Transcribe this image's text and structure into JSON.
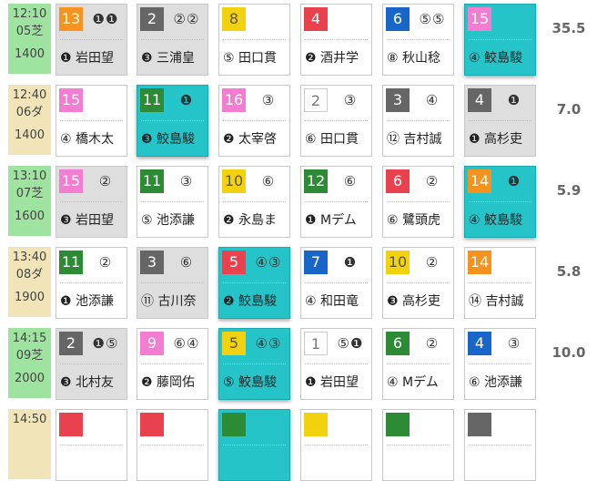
{
  "races": [
    {
      "time": "12:10",
      "race": "05芝",
      "distance": "1400",
      "surface": "turf",
      "odds": "35.5",
      "cells": [
        {
          "num": "13",
          "color": "c7",
          "marks": "❶❶",
          "jockey": "❶ 岩田望",
          "state": "dim"
        },
        {
          "num": "2",
          "color": "c2",
          "marks": "②②",
          "jockey": "❸ 三浦皇",
          "state": "dim"
        },
        {
          "num": "8",
          "color": "c5",
          "marks": "",
          "jockey": "⑤ 田口貫",
          "state": "normal"
        },
        {
          "num": "4",
          "color": "c3",
          "marks": "",
          "jockey": "❷ 酒井学",
          "state": "normal"
        },
        {
          "num": "6",
          "color": "c4",
          "marks": "⑤⑤",
          "jockey": "⑧ 秋山稔",
          "state": "normal"
        },
        {
          "num": "15",
          "color": "c8",
          "marks": "",
          "jockey": "④ 鮫島駿",
          "state": "hl"
        }
      ]
    },
    {
      "time": "12:40",
      "race": "06ダ",
      "distance": "1400",
      "surface": "dirt",
      "odds": "7.0",
      "cells": [
        {
          "num": "15",
          "color": "c8",
          "marks": "",
          "jockey": "④ 橋木太",
          "state": "normal"
        },
        {
          "num": "11",
          "color": "c6",
          "marks": "❶",
          "jockey": "❸ 鮫島駿",
          "state": "hl"
        },
        {
          "num": "16",
          "color": "c8",
          "marks": "③",
          "jockey": "❷ 太宰啓",
          "state": "normal"
        },
        {
          "num": "2",
          "color": "w1",
          "marks": "③",
          "jockey": "⑥ 田口貫",
          "state": "normal"
        },
        {
          "num": "3",
          "color": "c2",
          "marks": "④",
          "jockey": "⑫ 吉村誠",
          "state": "normal"
        },
        {
          "num": "4",
          "color": "c2",
          "marks": "❶",
          "jockey": "❶ 高杉吏",
          "state": "dim"
        }
      ]
    },
    {
      "time": "13:10",
      "race": "07芝",
      "distance": "1600",
      "surface": "turf",
      "odds": "5.9",
      "cells": [
        {
          "num": "15",
          "color": "c8",
          "marks": "②",
          "jockey": "❸ 岩田望",
          "state": "dim"
        },
        {
          "num": "11",
          "color": "c6",
          "marks": "③",
          "jockey": "⑤ 池添謙",
          "state": "normal"
        },
        {
          "num": "10",
          "color": "c5",
          "marks": "⑥",
          "jockey": "❷ 永島ま",
          "state": "normal"
        },
        {
          "num": "12",
          "color": "c6",
          "marks": "⑥",
          "jockey": "❶ Mデム",
          "state": "normal"
        },
        {
          "num": "6",
          "color": "c3",
          "marks": "②",
          "jockey": "⑥ 鷺頭虎",
          "state": "normal"
        },
        {
          "num": "14",
          "color": "c7",
          "marks": "❶",
          "jockey": "④ 鮫島駿",
          "state": "hl"
        }
      ]
    },
    {
      "time": "13:40",
      "race": "08ダ",
      "distance": "1900",
      "surface": "dirt",
      "odds": "5.8",
      "cells": [
        {
          "num": "11",
          "color": "c6",
          "marks": "②",
          "jockey": "❶ 池添謙",
          "state": "normal"
        },
        {
          "num": "3",
          "color": "c2",
          "marks": "⑥",
          "jockey": "⑪ 古川奈",
          "state": "dim"
        },
        {
          "num": "5",
          "color": "c3",
          "marks": "④③",
          "jockey": "❷ 鮫島駿",
          "state": "hl"
        },
        {
          "num": "7",
          "color": "c4",
          "marks": "❶",
          "jockey": "④ 和田竜",
          "state": "normal"
        },
        {
          "num": "10",
          "color": "c5",
          "marks": "②",
          "jockey": "❸ 高杉吏",
          "state": "normal"
        },
        {
          "num": "14",
          "color": "c7",
          "marks": "",
          "jockey": "⑭ 吉村誠",
          "state": "normal"
        }
      ]
    },
    {
      "time": "14:15",
      "race": "09芝",
      "distance": "2000",
      "surface": "turf",
      "odds": "10.0",
      "cells": [
        {
          "num": "2",
          "color": "c2",
          "marks": "❶⑤",
          "jockey": "❸ 北村友",
          "state": "dim"
        },
        {
          "num": "9",
          "color": "c8",
          "marks": "⑥④",
          "jockey": "❷ 藤岡佑",
          "state": "normal"
        },
        {
          "num": "5",
          "color": "c5",
          "marks": "④③",
          "jockey": "⑤ 鮫島駿",
          "state": "hl"
        },
        {
          "num": "1",
          "color": "w1",
          "marks": "⑤❶",
          "jockey": "❶ 岩田望",
          "state": "normal"
        },
        {
          "num": "6",
          "color": "c6",
          "marks": "②",
          "jockey": "④ Mデム",
          "state": "normal"
        },
        {
          "num": "4",
          "color": "c4",
          "marks": "③",
          "jockey": "⑥ 池添謙",
          "state": "normal"
        }
      ]
    },
    {
      "time": "14:50",
      "race": "",
      "distance": "",
      "surface": "dirt",
      "odds": "",
      "cells": [
        {
          "num": "",
          "color": "c3",
          "marks": "",
          "jockey": "",
          "state": "normal"
        },
        {
          "num": "",
          "color": "c3",
          "marks": "",
          "jockey": "",
          "state": "normal"
        },
        {
          "num": "",
          "color": "c6",
          "marks": "",
          "jockey": "",
          "state": "hl"
        },
        {
          "num": "",
          "color": "c5",
          "marks": "",
          "jockey": "",
          "state": "normal"
        },
        {
          "num": "",
          "color": "c6",
          "marks": "",
          "jockey": "",
          "state": "normal"
        },
        {
          "num": "",
          "color": "c2",
          "marks": "",
          "jockey": "",
          "state": "normal"
        }
      ]
    }
  ]
}
